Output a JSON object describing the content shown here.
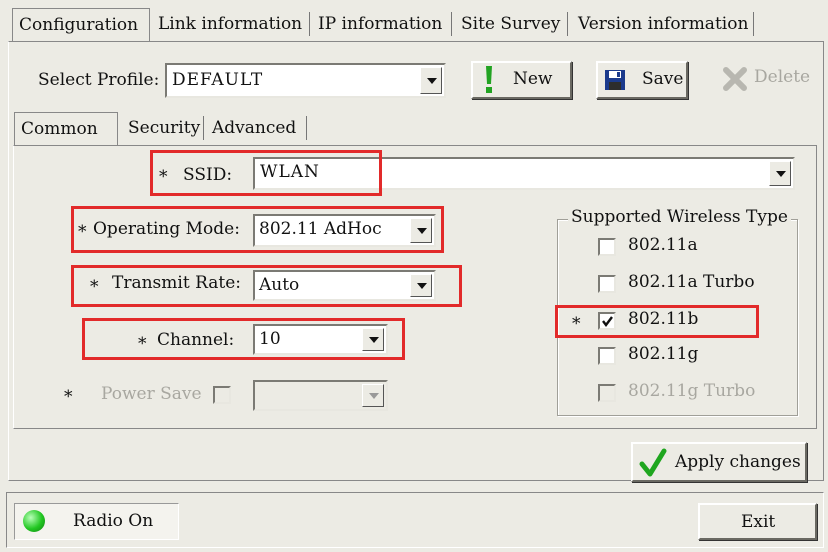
{
  "tabs": [
    "Configuration",
    "Link information",
    "IP information",
    "Site Survey",
    "Version information"
  ],
  "profile": {
    "label": "Select Profile:",
    "value": "DEFAULT",
    "new_label": "New",
    "save_label": "Save",
    "delete_label": "Delete"
  },
  "subtabs": [
    "Common",
    "Security",
    "Advanced"
  ],
  "required_marker": "*",
  "ssid": {
    "label": "SSID:",
    "value": "WLAN"
  },
  "operating_mode": {
    "label": "Operating Mode:",
    "value": "802.11 AdHoc"
  },
  "transmit_rate": {
    "label": "Transmit Rate:",
    "value": "Auto"
  },
  "channel": {
    "label": "Channel:",
    "value": "10"
  },
  "power_save": {
    "label": "Power Save",
    "checked": false,
    "value": ""
  },
  "wireless": {
    "title": "Supported Wireless Type",
    "items": [
      {
        "label": "802.11a",
        "checked": false,
        "enabled": true
      },
      {
        "label": "802.11a Turbo",
        "checked": false,
        "enabled": true
      },
      {
        "label": "802.11b",
        "checked": true,
        "enabled": true
      },
      {
        "label": "802.11g",
        "checked": false,
        "enabled": true
      },
      {
        "label": "802.11g Turbo",
        "checked": false,
        "enabled": false
      }
    ]
  },
  "apply_label": "Apply changes",
  "status": {
    "radio_label": "Radio On",
    "radio_color": "#22c722"
  },
  "exit_label": "Exit",
  "highlight_color": "#e22a2a"
}
